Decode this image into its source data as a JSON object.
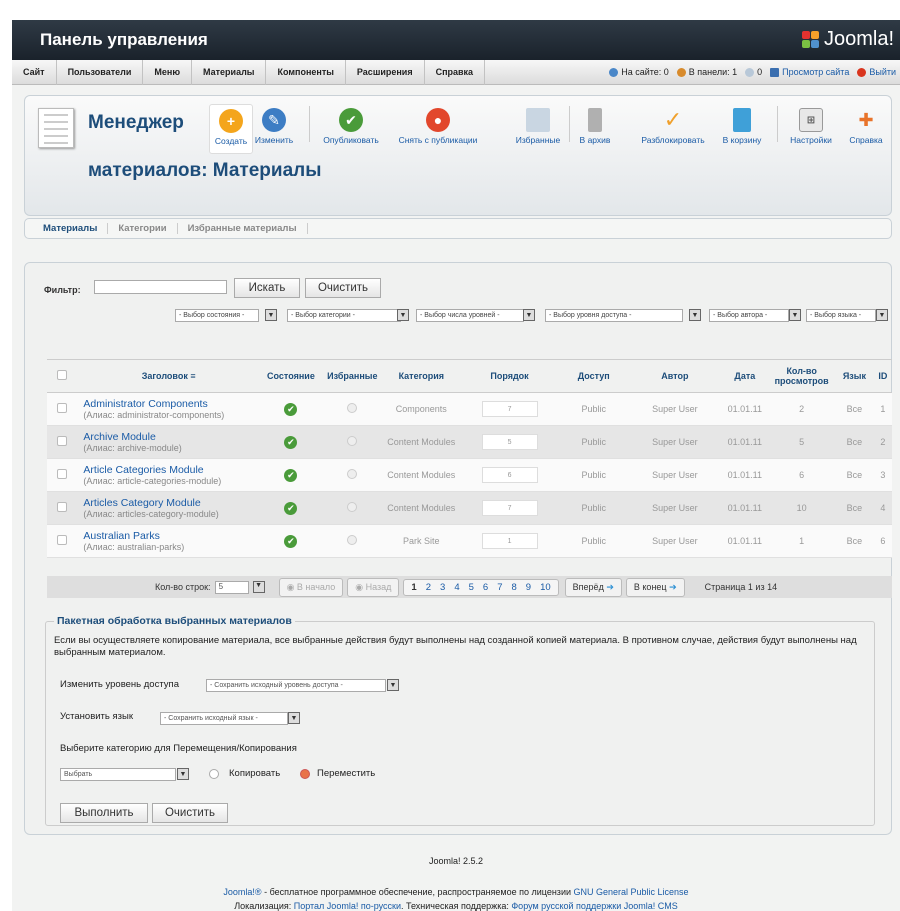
{
  "header": {
    "title": "Панель управления",
    "brand": "Joomla!"
  },
  "menu": [
    "Сайт",
    "Пользователи",
    "Меню",
    "Материалы",
    "Компоненты",
    "Расширения",
    "Справка"
  ],
  "status": {
    "on_site": "На сайте: 0",
    "in_panel": "В панели: 1",
    "messages": "0",
    "view_site": "Просмотр сайта",
    "logout": "Выйти"
  },
  "page": {
    "title_line1": "Менеджер",
    "title_line2": "материалов: Материалы"
  },
  "toolbar": [
    "Создать",
    "Изменить",
    "Опубликовать",
    "Снять с публикации",
    "Избранные",
    "В архив",
    "Разблокировать",
    "В корзину",
    "Настройки",
    "Справка"
  ],
  "tabs": [
    "Материалы",
    "Категории",
    "Избранные материалы"
  ],
  "filter": {
    "label": "Фильтр:",
    "value": "",
    "search": "Искать",
    "clear": "Очистить",
    "selects": [
      "- Выбор состояния -",
      "- Выбор категории -",
      "- Выбор числа уровней -",
      "- Выбор уровня доступа -",
      "- Выбор автора -",
      "- Выбор языка -"
    ]
  },
  "columns": [
    "Заголовок",
    "Состояние",
    "Избранные",
    "Категория",
    "Порядок",
    "Доступ",
    "Автор",
    "Дата",
    "Кол-во просмотров",
    "Язык",
    "ID"
  ],
  "rows": [
    {
      "title": "Administrator Components",
      "alias": "(Алиас: administrator-components)",
      "category": "Components",
      "order": "7",
      "access": "Public",
      "author": "Super User",
      "date": "01.01.11",
      "hits": "2",
      "lang": "Все",
      "id": "1"
    },
    {
      "title": "Archive Module",
      "alias": "(Алиас: archive-module)",
      "category": "Content Modules",
      "order": "5",
      "access": "Public",
      "author": "Super User",
      "date": "01.01.11",
      "hits": "5",
      "lang": "Все",
      "id": "2"
    },
    {
      "title": "Article Categories Module",
      "alias": "(Алиас: article-categories-module)",
      "category": "Content Modules",
      "order": "6",
      "access": "Public",
      "author": "Super User",
      "date": "01.01.11",
      "hits": "6",
      "lang": "Все",
      "id": "3"
    },
    {
      "title": "Articles Category Module",
      "alias": "(Алиас: articles-category-module)",
      "category": "Content Modules",
      "order": "7",
      "access": "Public",
      "author": "Super User",
      "date": "01.01.11",
      "hits": "10",
      "lang": "Все",
      "id": "4"
    },
    {
      "title": "Australian Parks",
      "alias": "(Алиас: australian-parks)",
      "category": "Park Site",
      "order": "1",
      "access": "Public",
      "author": "Super User",
      "date": "01.01.11",
      "hits": "1",
      "lang": "Все",
      "id": "6"
    }
  ],
  "pager": {
    "rows_label": "Кол-во строк:",
    "rows_value": "5",
    "start": "В начало",
    "prev": "Назад",
    "pages": [
      "1",
      "2",
      "3",
      "4",
      "5",
      "6",
      "7",
      "8",
      "9",
      "10"
    ],
    "next": "Вперёд",
    "end": "В конец",
    "info": "Страница 1 из 14"
  },
  "batch": {
    "legend": "Пакетная обработка выбранных материалов",
    "text": "Если вы осуществляете копирование материала, все выбранные действия будут выполнены над созданной копией материала. В противном случае, действия будут выполнены над выбранным материалом.",
    "access_label": "Изменить уровень доступа",
    "access_value": "- Сохранить исходный уровень доступа -",
    "lang_label": "Установить язык",
    "lang_value": "- Сохранить исходный язык -",
    "cat_label": "Выберите категорию для Перемещения/Копирования",
    "cat_value": "Выбрать",
    "copy": "Копировать",
    "move": "Переместить",
    "run": "Выполнить",
    "clear": "Очистить"
  },
  "footer": {
    "version": "Joomla! 2.5.2",
    "line1_a": "Joomla!®",
    "line1_b": " - бесплатное программное обеспечение, распространяемое по лицензии ",
    "line1_c": "GNU General Public License",
    "line2_a": "Локализация: ",
    "line2_b": "Портал Joomla! по-русски",
    "line2_c": ". Техническая поддержка: ",
    "line2_d": "Форум русской поддержки Joomla! CMS"
  }
}
